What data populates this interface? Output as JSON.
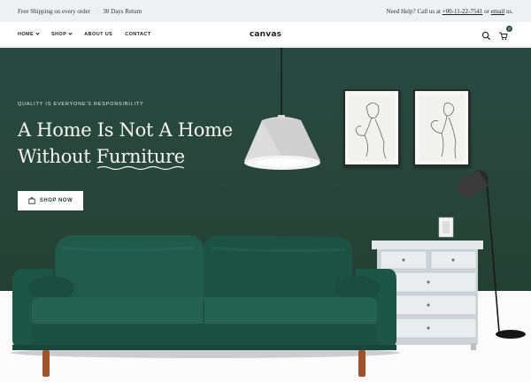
{
  "topbar": {
    "shipping": "Free Shipping on every order",
    "returns": "30 Days Return",
    "help_prefix": "Need Help? Call us at",
    "phone": "+00-11-22-7541",
    "or_text": "or",
    "email_label": "email",
    "help_suffix": "us."
  },
  "header": {
    "logo": "canvas",
    "nav": [
      {
        "label": "HOME"
      },
      {
        "label": "SHOP"
      },
      {
        "label": "ABOUT US"
      },
      {
        "label": "CONTACT"
      }
    ],
    "cart_count": "0"
  },
  "hero": {
    "tagline": "QUALITY IS EVERYONE'S RESPONSIBILITY",
    "headline_line1": "A Home Is Not A Home",
    "headline_line2_pre": "Without ",
    "headline_line2_underlined": "Furniture",
    "button_label": "SHOP NOW"
  },
  "colors": {
    "accent": "#2d4b42",
    "hero_bg": "#264338",
    "sofa": "#1f5a4b"
  },
  "icons": [
    "search-icon",
    "cart-icon",
    "bag-icon",
    "chevron-down-icon"
  ]
}
